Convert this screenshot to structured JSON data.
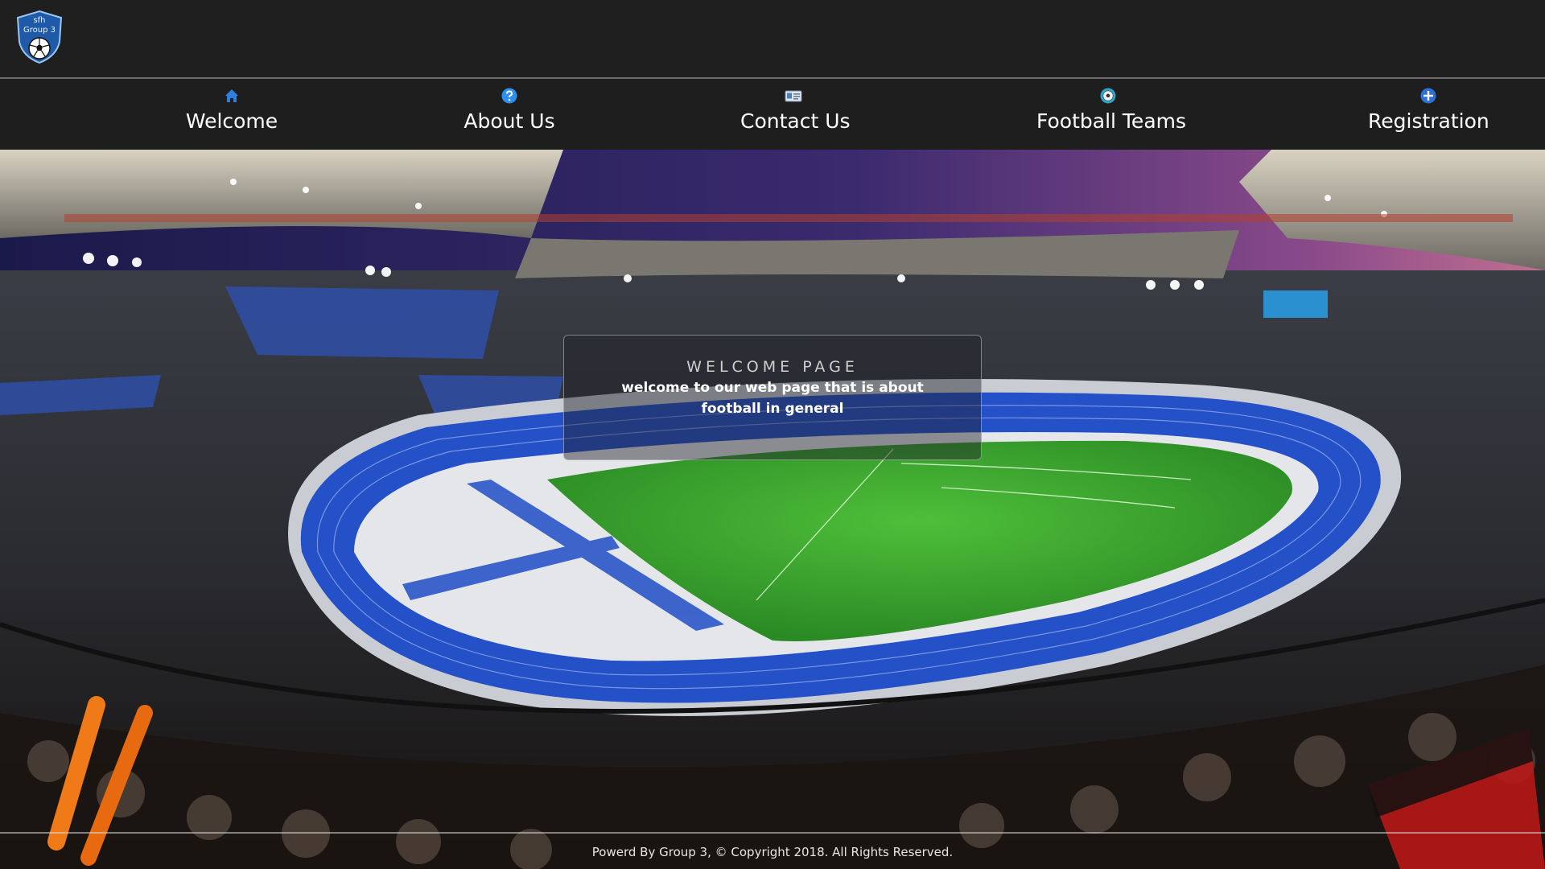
{
  "logo": {
    "line1": "sfh",
    "line2": "Group 3",
    "icon": "soccer-ball-shield-icon"
  },
  "nav": {
    "items": [
      {
        "label": "Welcome",
        "icon": "home-icon"
      },
      {
        "label": "About Us",
        "icon": "question-icon"
      },
      {
        "label": "Contact Us",
        "icon": "contact-card-icon"
      },
      {
        "label": "Football Teams",
        "icon": "soccer-ball-icon"
      },
      {
        "label": "Registration",
        "icon": "plus-circle-icon"
      }
    ]
  },
  "welcome": {
    "title": "WELCOME PAGE",
    "text": "welcome to our web page that is about football in general"
  },
  "footer": {
    "text": "Powerd By Group 3, © Copyright 2018. All Rights Reserved."
  },
  "colors": {
    "header_bg": "#1f1f1f",
    "nav_icon_blue": "#2d7fe0",
    "track_blue": "#2450c8",
    "pitch_green": "#3aa032"
  }
}
